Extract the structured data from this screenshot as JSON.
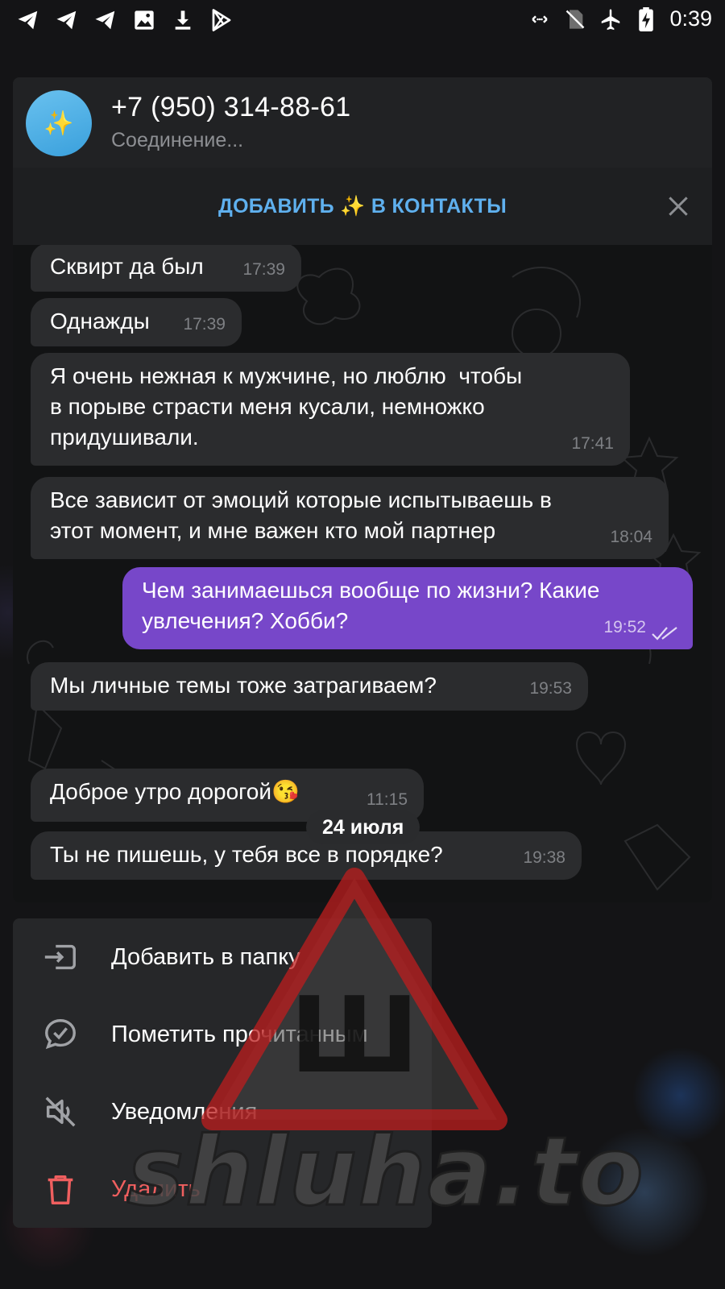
{
  "status_bar": {
    "time": "0:39",
    "left_icons": [
      "telegram-icon",
      "telegram-icon",
      "telegram-icon",
      "image-icon",
      "download-icon",
      "play-store-icon"
    ],
    "right_icons": [
      "data-saver-icon",
      "no-sim-icon",
      "airplane-icon",
      "battery-charging-icon"
    ]
  },
  "chat": {
    "title": "+7 (950) 314-88-61",
    "status": "Соединение...",
    "avatar_emoji": "✨"
  },
  "add_contact": {
    "label_part1": "ДОБАВИТЬ",
    "emoji": "✨",
    "label_part2": "В КОНТАКТЫ"
  },
  "messages": [
    {
      "direction": "in",
      "text": "Сквирт да был",
      "time": "17:39"
    },
    {
      "direction": "in",
      "text": "Однажды",
      "time": "17:39"
    },
    {
      "direction": "in",
      "text": "Я очень нежная к мужчине, но люблю  чтобы\nв порыве страсти меня кусали, немножко\nпридушивали.",
      "time": "17:41"
    },
    {
      "direction": "in",
      "text": "Все зависит от эмоций которые испытываешь в\nэтот момент, и мне важен кто мой партнер",
      "time": "18:04"
    },
    {
      "direction": "out",
      "text": "Чем занимаешься вообще по жизни? Какие\nувлечения? Хобби?",
      "time": "19:52",
      "read": true
    },
    {
      "direction": "in",
      "text": "Мы личные темы тоже затрагиваем?",
      "time": "19:53"
    },
    {
      "direction": "in",
      "text": "Доброе утро дорогой😘",
      "time": "11:15"
    },
    {
      "direction": "in",
      "text": "Ты не пишешь, у тебя все в порядке?",
      "time": "19:38"
    }
  ],
  "date_separator": "24 июля",
  "context_menu": [
    {
      "label": "Добавить в папку",
      "icon": "folder-add-icon"
    },
    {
      "label": "Пометить прочитанным",
      "icon": "chat-check-icon"
    },
    {
      "label": "Уведомления",
      "icon": "mute-icon"
    },
    {
      "label": "Удалить",
      "icon": "trash-icon",
      "danger": true
    }
  ],
  "watermark": {
    "text": "shluha.to",
    "sign_letter": "Ш"
  },
  "colors": {
    "accent_link": "#5fb0ee",
    "outgoing_bubble": "#7747c9",
    "incoming_bubble": "#2b2c2e",
    "danger": "#ef5f5f",
    "background": "#141416"
  }
}
